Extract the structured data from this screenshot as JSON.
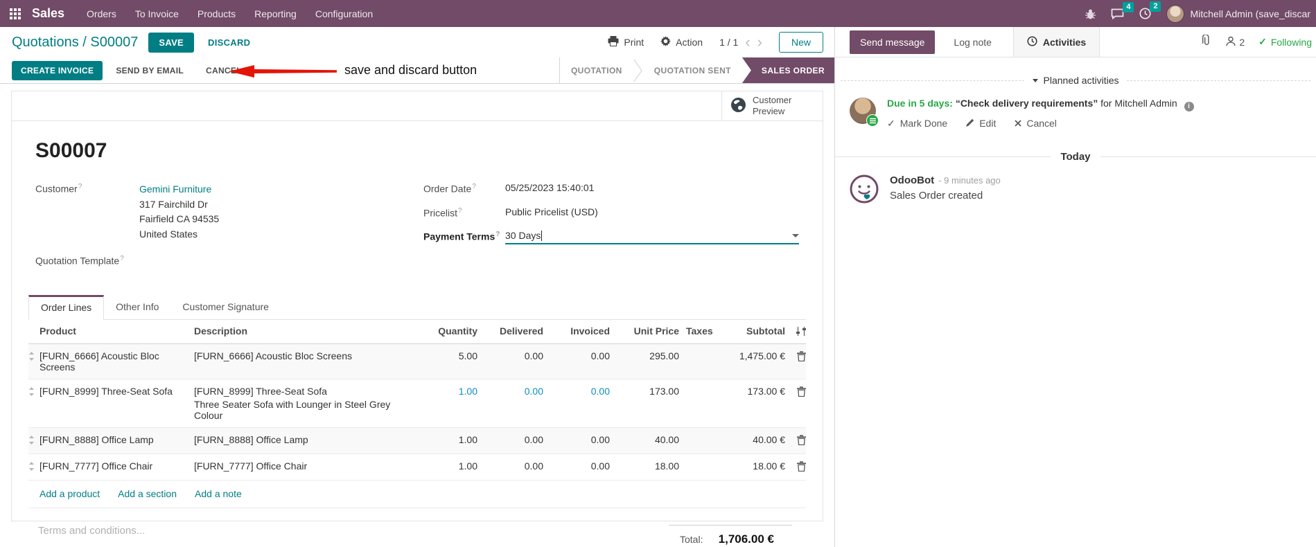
{
  "colors": {
    "brand": "#714B67",
    "accent": "#017e84",
    "badge": "#00A09D",
    "success": "#28a745",
    "arrow_red": "#e31507",
    "modified": "#0d8dc0"
  },
  "navbar": {
    "app_name": "Sales",
    "menus": [
      {
        "label": "Orders"
      },
      {
        "label": "To Invoice"
      },
      {
        "label": "Products"
      },
      {
        "label": "Reporting"
      },
      {
        "label": "Configuration"
      }
    ],
    "messages_badge": "4",
    "activities_badge": "2",
    "user_name": "Mitchell Admin (save_discar"
  },
  "control_panel": {
    "breadcrumb_parent": "Quotations",
    "breadcrumb_sep": "/",
    "breadcrumb_current": "S00007",
    "save": "SAVE",
    "discard": "DISCARD",
    "annotation": "save and discard button",
    "print": "Print",
    "action": "Action",
    "pager": "1 / 1",
    "prev": "‹",
    "next": "›",
    "new": "New"
  },
  "action_buttons": {
    "create_invoice": "CREATE INVOICE",
    "send_by_email": "SEND BY EMAIL",
    "cancel": "CANCEL"
  },
  "statusbar": {
    "steps": [
      {
        "label": "QUOTATION"
      },
      {
        "label": "QUOTATION SENT"
      },
      {
        "label": "SALES ORDER",
        "active": true
      }
    ]
  },
  "sheet": {
    "customer_preview": "Customer Preview",
    "title": "S00007",
    "help_marker": "?",
    "fields": {
      "customer_label": "Customer",
      "customer_value": "Gemini Furniture",
      "address_line1": "317 Fairchild Dr",
      "address_line2": "Fairfield CA 94535",
      "address_line3": "United States",
      "quotation_template_label": "Quotation Template",
      "order_date_label": "Order Date",
      "order_date_value": "05/25/2023 15:40:01",
      "pricelist_label": "Pricelist",
      "pricelist_value": "Public Pricelist (USD)",
      "payment_terms_label": "Payment Terms",
      "payment_terms_value": "30 Days"
    },
    "tabs": [
      {
        "label": "Order Lines",
        "active": true
      },
      {
        "label": "Other Info"
      },
      {
        "label": "Customer Signature"
      }
    ],
    "order_lines": {
      "columns": {
        "product": "Product",
        "description": "Description",
        "quantity": "Quantity",
        "delivered": "Delivered",
        "invoiced": "Invoiced",
        "unit_price": "Unit Price",
        "taxes": "Taxes",
        "subtotal": "Subtotal"
      },
      "rows": [
        {
          "product": "[FURN_6666] Acoustic Bloc Screens",
          "description": "[FURN_6666] Acoustic Bloc Screens",
          "quantity": "5.00",
          "delivered": "0.00",
          "invoiced": "0.00",
          "unit_price": "295.00",
          "taxes": "",
          "subtotal": "1,475.00 €"
        },
        {
          "product": "[FURN_8999] Three-Seat Sofa",
          "description": "[FURN_8999] Three-Seat Sofa",
          "description2": "Three Seater Sofa with Lounger in Steel Grey Colour",
          "quantity": "1.00",
          "delivered": "0.00",
          "invoiced": "0.00",
          "unit_price": "173.00",
          "taxes": "",
          "subtotal": "173.00 €"
        },
        {
          "product": "[FURN_8888] Office Lamp",
          "description": "[FURN_8888] Office Lamp",
          "quantity": "1.00",
          "delivered": "0.00",
          "invoiced": "0.00",
          "unit_price": "40.00",
          "taxes": "",
          "subtotal": "40.00 €"
        },
        {
          "product": "[FURN_7777] Office Chair",
          "description": "[FURN_7777] Office Chair",
          "quantity": "1.00",
          "delivered": "0.00",
          "invoiced": "0.00",
          "unit_price": "18.00",
          "taxes": "",
          "subtotal": "18.00 €"
        }
      ],
      "add_product": "Add a product",
      "add_section": "Add a section",
      "add_note": "Add a note"
    },
    "terms_placeholder": "Terms and conditions...",
    "total_label": "Total:",
    "total_value": "1,706.00 €"
  },
  "chatter": {
    "send_message": "Send message",
    "log_note": "Log note",
    "activities_tab": "Activities",
    "followers_count": "2",
    "following": "Following",
    "following_check": "✓",
    "planned_header": "Planned activities",
    "activity": {
      "due": "Due in 5 days:",
      "summary": "“Check delivery requirements”",
      "assignee": "for Mitchell Admin",
      "info": "i",
      "mark_done_check": "✓",
      "mark_done": "Mark Done",
      "edit": "Edit",
      "cancel": "Cancel"
    },
    "today": "Today",
    "message": {
      "author": "OdooBot",
      "time": "- 9 minutes ago",
      "body": "Sales Order created"
    }
  }
}
